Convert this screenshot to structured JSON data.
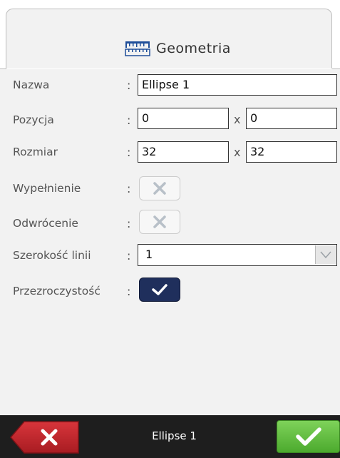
{
  "tab": {
    "title": "Geometria",
    "icon": "ruler-icon",
    "accent": "#1f4e99"
  },
  "form": {
    "separator": ":",
    "name": {
      "label": "Nazwa",
      "value": "Ellipse 1"
    },
    "position": {
      "label": "Pozycja",
      "x": "0",
      "y": "0",
      "sep": "x"
    },
    "size": {
      "label": "Rozmiar",
      "width": "32",
      "height": "32",
      "sep": "x"
    },
    "fill": {
      "label": "Wypełnienie",
      "checked": false
    },
    "inverted": {
      "label": "Odwrócenie",
      "checked": false
    },
    "line_width": {
      "label": "Szerokość linii",
      "value": "1"
    },
    "transparency": {
      "label": "Przezroczystość",
      "checked": true
    }
  },
  "bottom_bar": {
    "title": "Ellipse 1",
    "cancel_icon": "close-icon",
    "ok_icon": "check-icon",
    "cancel_color": "#c0282e",
    "ok_color": "#5cb83a"
  }
}
